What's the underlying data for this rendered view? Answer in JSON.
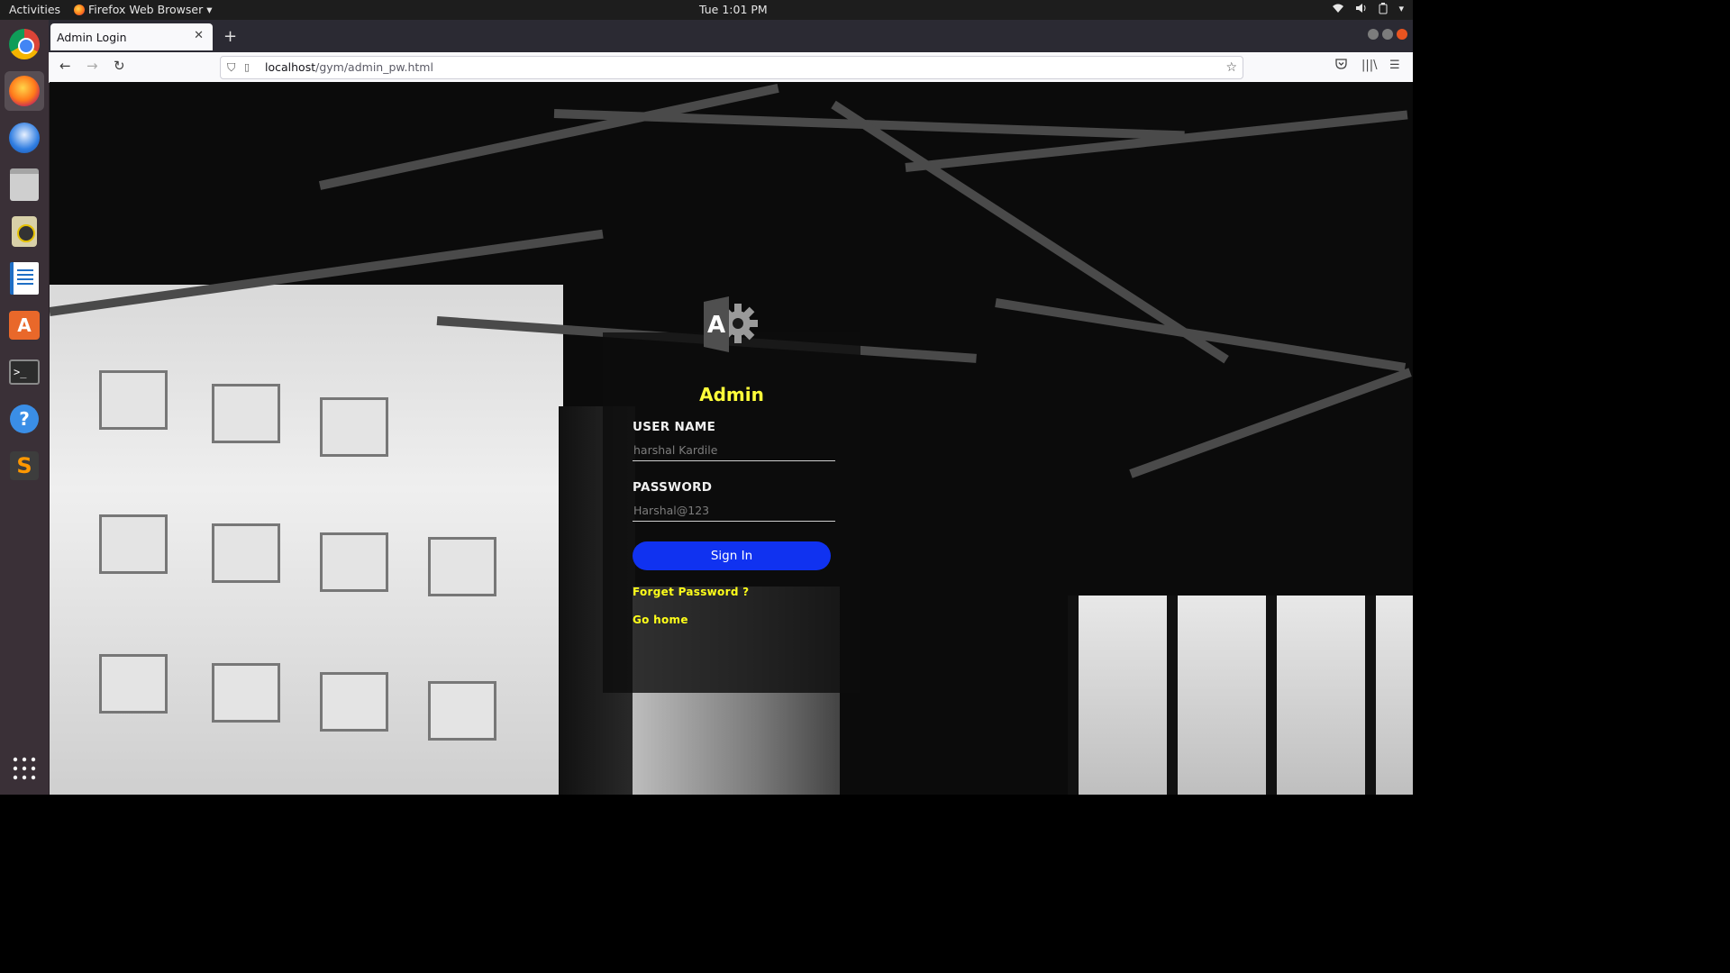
{
  "topbar": {
    "activities": "Activities",
    "app_name": "Firefox Web Browser",
    "clock": "Tue  1:01 PM"
  },
  "dock": {
    "items": [
      "chrome-icon",
      "firefox-icon",
      "thunderbird-icon",
      "files-icon",
      "rhythmbox-icon",
      "writer-icon",
      "software-center-icon",
      "terminal-icon",
      "help-icon",
      "sublime-text-icon"
    ],
    "apps_grid_icon": "show-applications-icon"
  },
  "browser": {
    "tab_title": "Admin Login",
    "url_host": "localhost",
    "url_path": "/gym/admin_pw.html"
  },
  "login": {
    "title": "Admin",
    "logo_letter": "A",
    "username_label": "USER NAME",
    "username_placeholder": "harshal Kardile",
    "password_label": "PASSWORD",
    "password_placeholder": "Harshal@123",
    "signin_label": "Sign In",
    "forgot_link": "Forget Password ?",
    "home_link": "Go home"
  },
  "colors": {
    "accent_yellow": "#ffff3a",
    "signin_blue": "#1032f0",
    "dock_bg": "#3a3037"
  }
}
